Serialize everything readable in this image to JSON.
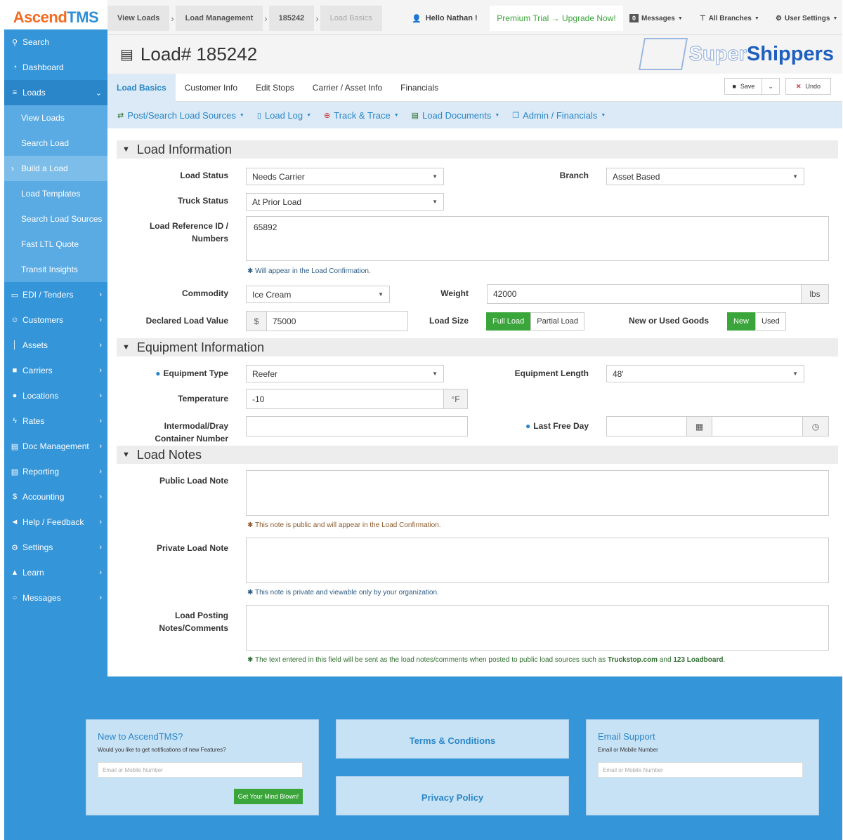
{
  "app": {
    "logo_a": "Ascend",
    "logo_b": "TMS"
  },
  "breadcrumb": [
    "View Loads",
    "Load Management",
    "185242",
    "Load Basics"
  ],
  "topbar": {
    "greeting": "Hello Nathan !",
    "trial": "Premium Trial → Upgrade Now!",
    "messages_label": "Messages",
    "messages_count": "0",
    "branches": "All Branches",
    "settings": "User Settings"
  },
  "sidebar": {
    "items": [
      {
        "icon": "search-icon",
        "glyph": "⚲",
        "label": "Search"
      },
      {
        "icon": "dashboard-icon",
        "glyph": "◔",
        "label": "Dashboard"
      },
      {
        "icon": "list-icon",
        "glyph": "≡",
        "label": "Loads"
      }
    ],
    "loads_sub": [
      "View Loads",
      "Search Load",
      "Build a Load",
      "Load Templates",
      "Search Load Sources",
      "Fast LTL Quote",
      "Transit Insights"
    ],
    "items2": [
      {
        "icon": "edi-icon",
        "glyph": "▭",
        "label": "EDI / Tenders"
      },
      {
        "icon": "users-icon",
        "glyph": "☺",
        "label": "Customers"
      },
      {
        "icon": "barcode-icon",
        "glyph": "│",
        "label": "Assets"
      },
      {
        "icon": "truck-icon",
        "glyph": "■",
        "label": "Carriers"
      },
      {
        "icon": "map-pin-icon",
        "glyph": "●",
        "label": "Locations"
      },
      {
        "icon": "bolt-icon",
        "glyph": "ϟ",
        "label": "Rates"
      },
      {
        "icon": "doc-icon",
        "glyph": "▤",
        "label": "Doc Management"
      },
      {
        "icon": "report-icon",
        "glyph": "▤",
        "label": "Reporting"
      },
      {
        "icon": "dollar-icon",
        "glyph": "$",
        "label": "Accounting"
      },
      {
        "icon": "megaphone-icon",
        "glyph": "◄",
        "label": "Help / Feedback"
      },
      {
        "icon": "gears-icon",
        "glyph": "⚙",
        "label": "Settings"
      },
      {
        "icon": "grad-cap-icon",
        "glyph": "▲",
        "label": "Learn"
      },
      {
        "icon": "chat-icon",
        "glyph": "○",
        "label": "Messages"
      }
    ]
  },
  "page": {
    "title": "Load# 185242",
    "brand_a": "Super",
    "brand_b": "Shippers"
  },
  "tabs": [
    "Load Basics",
    "Customer Info",
    "Edit Stops",
    "Carrier / Asset Info",
    "Financials"
  ],
  "buttons": {
    "save": "Save",
    "undo": "Undo"
  },
  "subnav": [
    "Post/Search Load Sources",
    "Load Log",
    "Track & Trace",
    "Load Documents",
    "Admin / Financials"
  ],
  "sections": {
    "load": "Load Information",
    "equip": "Equipment Information",
    "notes": "Load Notes"
  },
  "load": {
    "status_label": "Load Status",
    "status": "Needs Carrier",
    "branch_label": "Branch",
    "branch": "Asset Based",
    "truck_label": "Truck Status",
    "truck": "At Prior Load",
    "ref_label_1": "Load Reference ID /",
    "ref_label_2": "Numbers",
    "ref": "65892",
    "ref_help": "Will appear in the Load Confirmation.",
    "commodity_label": "Commodity",
    "commodity": "Ice Cream",
    "weight_label": "Weight",
    "weight": "42000",
    "weight_unit": "lbs",
    "value_label": "Declared Load Value",
    "currency": "$",
    "value": "75000",
    "size_label": "Load Size",
    "size_full": "Full Load",
    "size_partial": "Partial Load",
    "goods_label": "New or Used Goods",
    "goods_new": "New",
    "goods_used": "Used"
  },
  "equip": {
    "type_label": "Equipment Type",
    "type": "Reefer",
    "length_label": "Equipment Length",
    "length": "48'",
    "temp_label": "Temperature",
    "temp": "-10",
    "temp_unit": "°F",
    "container_label_1": "Intermodal/Dray",
    "container_label_2": "Container Number",
    "free_day_label": "Last Free Day"
  },
  "notes": {
    "public_label": "Public Load Note",
    "public_help": "This note is public and will appear in the Load Confirmation.",
    "private_label": "Private Load Note",
    "private_help": "This note is private and viewable only by your organization.",
    "posting_label_1": "Load Posting",
    "posting_label_2": "Notes/Comments",
    "posting_help_a": "The text entered in this field will be sent as the load notes/comments when posted to public load sources such as ",
    "posting_help_b": "Truckstop.com",
    "posting_help_c": " and ",
    "posting_help_d": "123 Loadboard",
    "posting_help_e": "."
  },
  "footer": {
    "new_title": "New to AscendTMS?",
    "new_desc": "Would you like to get notifications of new Features?",
    "new_placeholder": "Email or Mobile Number",
    "new_button": "Get Your Mind Blown!",
    "terms": "Terms & Conditions",
    "privacy": "Privacy Policy",
    "support_title": "Email Support",
    "support_desc": "Email or Mobile Number",
    "support_placeholder": "Email or Mobile Number"
  },
  "colors": {
    "accent": "#3595d9",
    "orange": "#f26b21",
    "green": "#3aa53a"
  }
}
